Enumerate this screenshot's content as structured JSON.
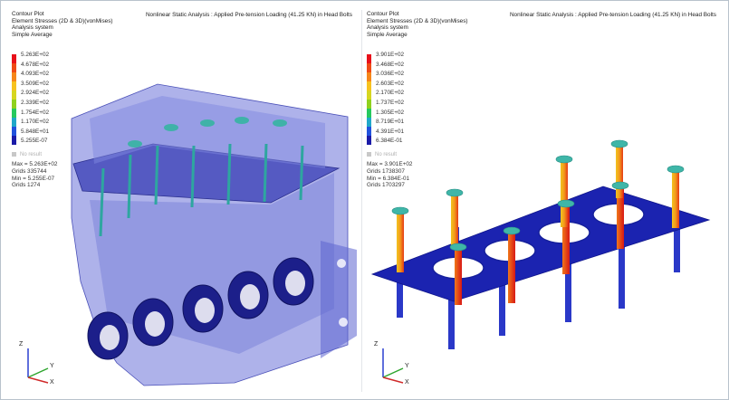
{
  "left_view": {
    "title": "Nonlinear Static Analysis : Applied Pre-tension Loading (41.25 KN) in Head Bolts",
    "header_lines": [
      "Contour Plot",
      "Element Stresses (2D & 3D)(vonMises)",
      "Analysis system",
      "Simple Average"
    ],
    "legend_values": [
      "5.263E+02",
      "4.678E+02",
      "4.093E+02",
      "3.509E+02",
      "2.924E+02",
      "2.339E+02",
      "1.754E+02",
      "1.170E+02",
      "5.848E+01",
      "5.255E-07"
    ],
    "no_result": "No result",
    "stats": [
      "Max = 5.263E+02",
      "Grids 335744",
      "Min = 5.255E-07",
      "Grids 1274"
    ]
  },
  "right_view": {
    "title": "Nonlinear Static Analysis : Applied Pre-tension Loading (41.25 KN) in Head Bolts",
    "header_lines": [
      "Contour Plot",
      "Element Stresses (2D & 3D)(vonMises)",
      "Analysis system",
      "Simple Average"
    ],
    "legend_values": [
      "3.901E+02",
      "3.468E+02",
      "3.036E+02",
      "2.603E+02",
      "2.170E+02",
      "1.737E+02",
      "1.305E+02",
      "8.719E+01",
      "4.391E+01",
      "6.384E-01"
    ],
    "no_result": "No result",
    "stats": [
      "Max = 3.901E+02",
      "Grids 1738307",
      "Min = 6.384E-01",
      "Grids 1703297"
    ]
  },
  "legend_colors": [
    "#e8101a",
    "#ef4a16",
    "#f6861a",
    "#f7c21f",
    "#d6d620",
    "#8fd11d",
    "#26c95e",
    "#1fa8c9",
    "#2152dd",
    "#1b1ba8"
  ],
  "triad": {
    "z": "Z",
    "y": "Y",
    "x": "X"
  }
}
